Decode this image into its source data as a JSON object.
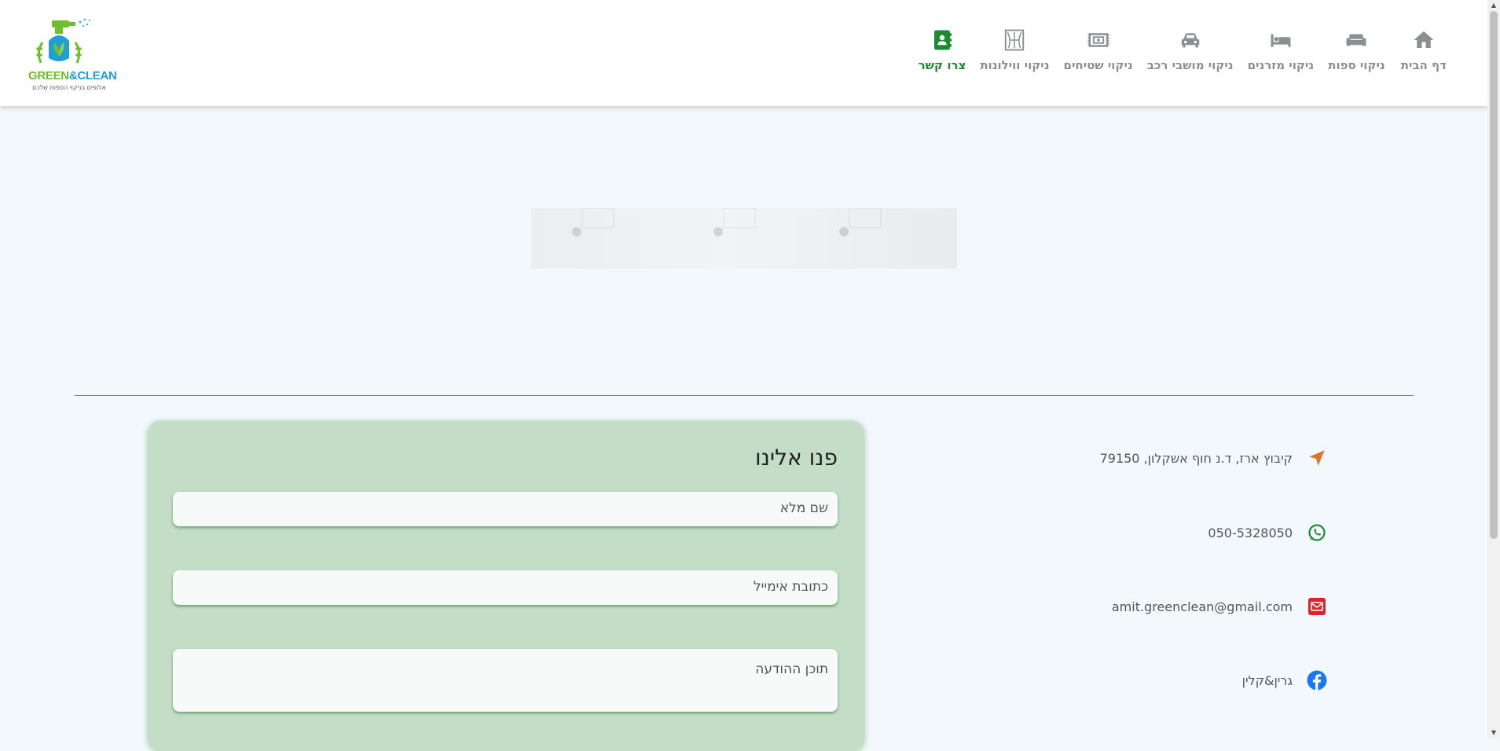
{
  "logo": {
    "word1": "GREEN",
    "amp": "&",
    "word2": "CLEAN",
    "tagline": "אלופים בניקוי הספות שלכם"
  },
  "nav": {
    "items": [
      {
        "label": "דף הבית",
        "icon": "home-icon"
      },
      {
        "label": "ניקוי ספות",
        "icon": "sofa-icon"
      },
      {
        "label": "ניקוי מזרנים",
        "icon": "bed-icon"
      },
      {
        "label": "ניקוי מושבי רכב",
        "icon": "car-icon"
      },
      {
        "label": "ניקוי שטיחים",
        "icon": "rug-icon"
      },
      {
        "label": "ניקוי ווילונות",
        "icon": "curtain-icon"
      },
      {
        "label": "צרו קשר",
        "icon": "contact-book-icon",
        "active": true
      }
    ]
  },
  "form": {
    "title": "פנו אלינו",
    "name_placeholder": "שם מלא",
    "email_placeholder": "כתובת אימייל",
    "message_placeholder": "תוכן ההודעה"
  },
  "contact": {
    "address": "קיבוץ ארז, ד.נ חוף אשקלון, 79150",
    "phone": "050-5328050",
    "email": "amit.greenclean@gmail.com",
    "facebook": "גרין&קלין"
  },
  "colors": {
    "active_nav": "#1d8a2e",
    "nav_text": "#8a8f94",
    "form_bg": "#c3ddc6",
    "address_icon": "#d9782a",
    "whatsapp_icon": "#1d8a2e",
    "email_icon": "#e0222b",
    "facebook_icon": "#1877f2"
  }
}
